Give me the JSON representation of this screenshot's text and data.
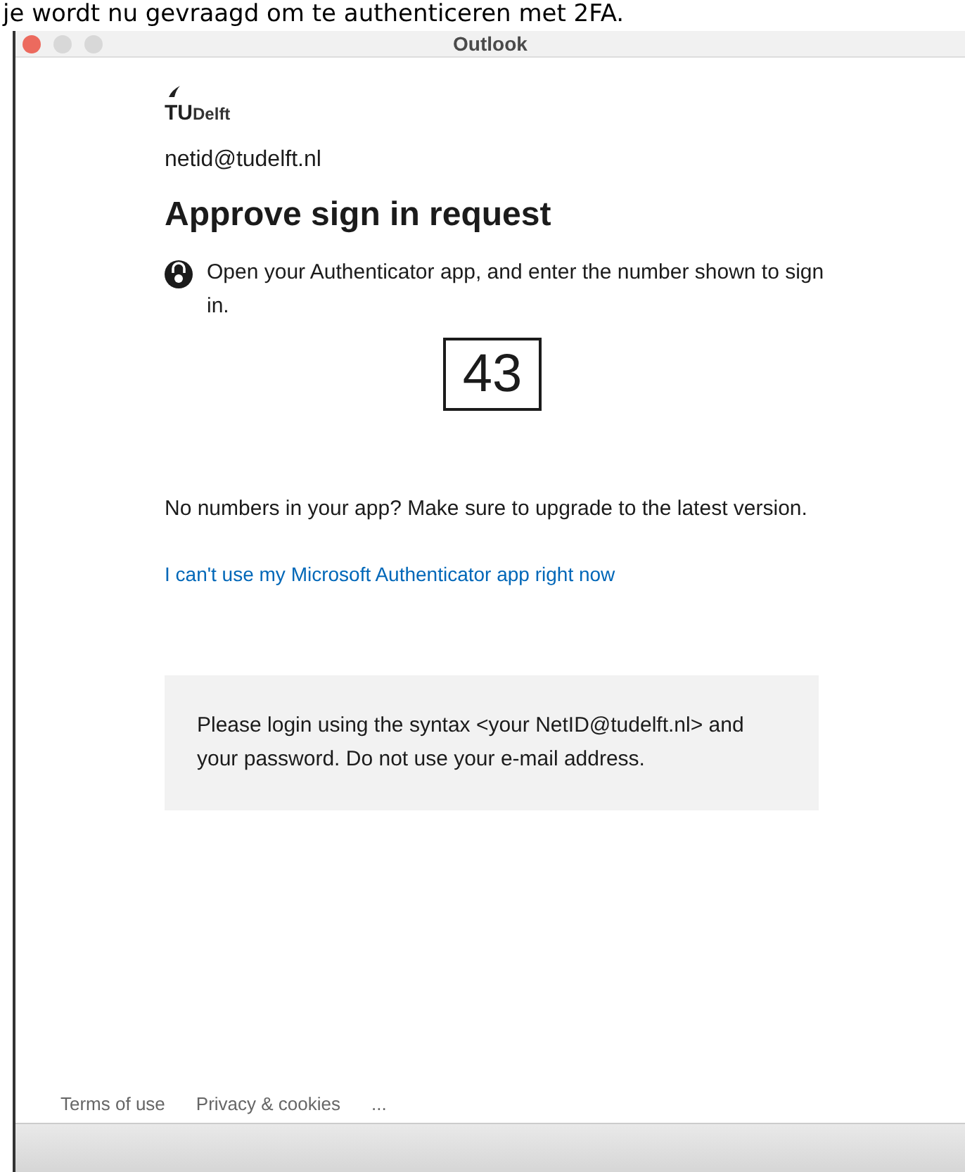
{
  "caption": "je wordt nu gevraagd om te authenticeren met 2FA.",
  "window": {
    "title": "Outlook"
  },
  "logo": {
    "prefix": "TU",
    "suffix": "Delft"
  },
  "account": "netid@tudelft.nl",
  "heading": "Approve sign in request",
  "instruction": "Open your Authenticator app, and enter the number shown to sign in.",
  "number": "43",
  "upgrade_note": "No numbers in your app? Make sure to upgrade to the latest version.",
  "alt_link": "I can't use my Microsoft Authenticator app right now",
  "info_box": "Please login using the syntax <your NetID@tudelft.nl> and your password. Do not use your e-mail address.",
  "footer_links": [
    "Terms of use",
    "Privacy & cookies",
    "..."
  ]
}
